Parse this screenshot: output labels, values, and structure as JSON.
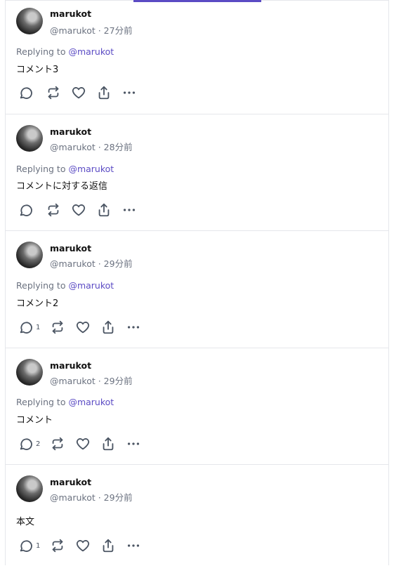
{
  "posts": [
    {
      "name": "marukot",
      "meta": "@marukot · 27分前",
      "replying_prefix": "Replying to ",
      "replying_handle": "@marukot",
      "body": "コメント3",
      "reply_count": ""
    },
    {
      "name": "marukot",
      "meta": "@marukot · 28分前",
      "replying_prefix": "Replying to ",
      "replying_handle": "@marukot",
      "body": "コメントに対する返信",
      "reply_count": ""
    },
    {
      "name": "marukot",
      "meta": "@marukot · 29分前",
      "replying_prefix": "Replying to ",
      "replying_handle": "@marukot",
      "body": "コメント2",
      "reply_count": "1"
    },
    {
      "name": "marukot",
      "meta": "@marukot · 29分前",
      "replying_prefix": "Replying to ",
      "replying_handle": "@marukot",
      "body": "コメント",
      "reply_count": "2"
    },
    {
      "name": "marukot",
      "meta": "@marukot · 29分前",
      "body": "本文",
      "reply_count": "1"
    }
  ],
  "colors": {
    "accent": "#5b4bc4",
    "muted_text": "#6b7280",
    "divider": "#e5e7eb"
  },
  "icons": [
    "comment-icon",
    "repost-icon",
    "like-icon",
    "share-icon",
    "more-icon"
  ]
}
